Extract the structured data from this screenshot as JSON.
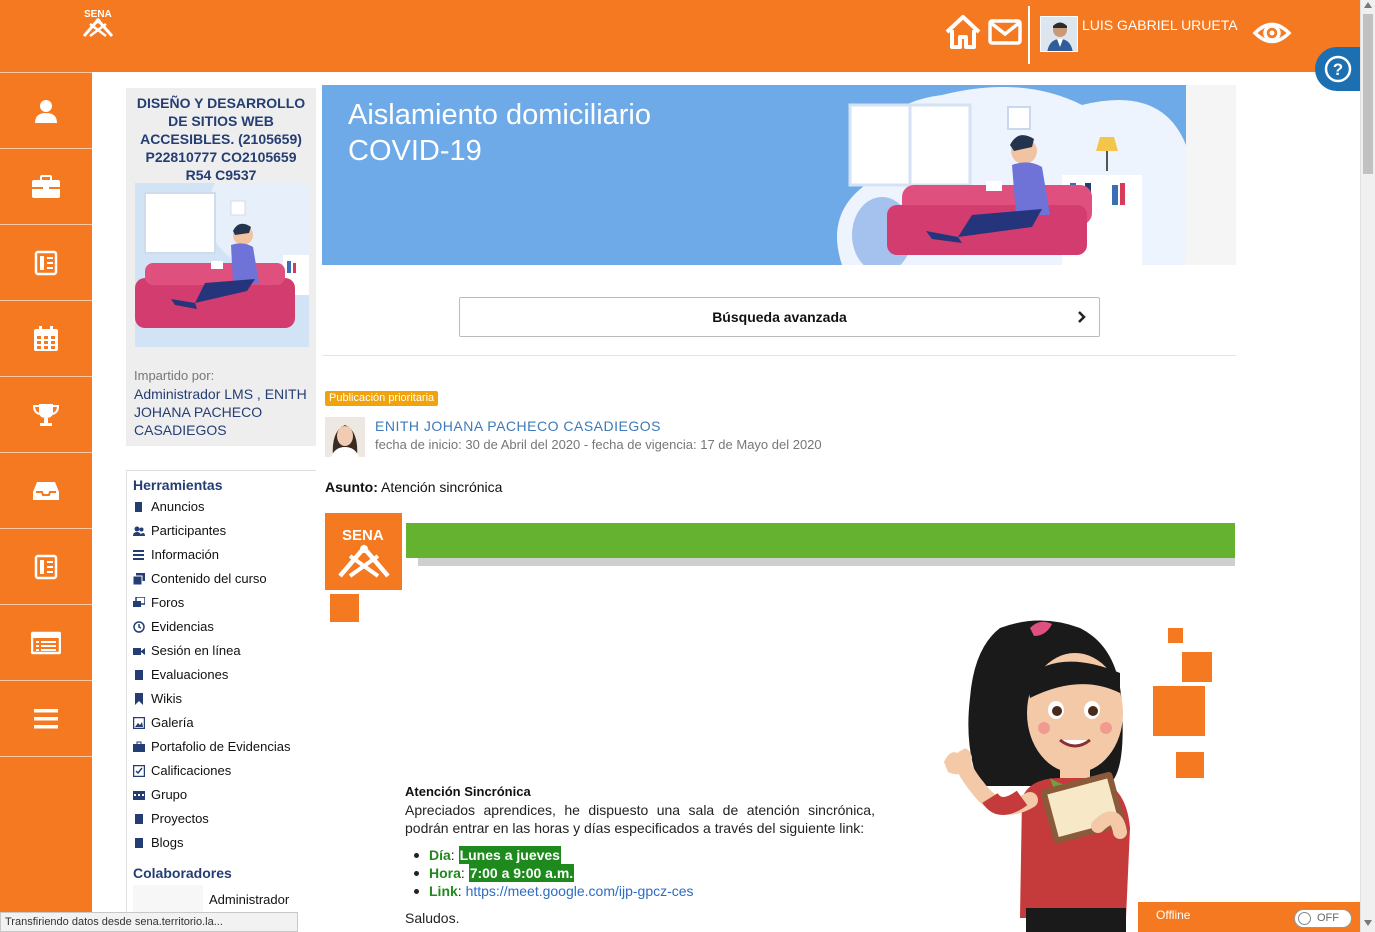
{
  "header": {
    "logo_text": "SENA",
    "user_name": "LUIS GABRIEL URUETA",
    "brand_color": "#f47920",
    "help_label": "?"
  },
  "sidebar": {
    "icons": [
      "user-icon",
      "briefcase-icon",
      "book-icon",
      "calendar-icon",
      "trophy-icon",
      "inbox-icon",
      "book-icon",
      "list-icon",
      "menu-icon"
    ]
  },
  "course": {
    "title": "DISEÑO Y DESARROLLO DE SITIOS WEB ACCESIBLES. (2105659) P22810777 CO2105659 R54 C9537",
    "taught_label": "Impartido por:",
    "taught_names": "Administrador LMS , ENITH JOHANA PACHECO CASADIEGOS"
  },
  "tools": {
    "title": "Herramientas",
    "items": [
      {
        "label": "Anuncios",
        "icon": "announcement-icon"
      },
      {
        "label": "Participantes",
        "icon": "participants-icon"
      },
      {
        "label": "Información",
        "icon": "info-icon"
      },
      {
        "label": "Contenido del curso",
        "icon": "content-icon"
      },
      {
        "label": "Foros",
        "icon": "forum-icon"
      },
      {
        "label": "Evidencias",
        "icon": "evidence-icon"
      },
      {
        "label": "Sesión en línea",
        "icon": "video-icon"
      },
      {
        "label": "Evaluaciones",
        "icon": "evaluation-icon"
      },
      {
        "label": "Wikis",
        "icon": "bookmark-icon"
      },
      {
        "label": "Galería",
        "icon": "gallery-icon"
      },
      {
        "label": "Portafolio de Evidencias",
        "icon": "portfolio-icon"
      },
      {
        "label": "Calificaciones",
        "icon": "grades-icon"
      },
      {
        "label": "Grupo",
        "icon": "group-icon"
      },
      {
        "label": "Proyectos",
        "icon": "projects-icon"
      },
      {
        "label": "Blogs",
        "icon": "blog-icon"
      }
    ],
    "collaborators_title": "Colaboradores",
    "collaborator_name": "Administrador"
  },
  "status_bar": "Transfiriendo datos desde sena.territorio.la...",
  "banner": {
    "line1": "Aislamiento domiciliario",
    "line2": "COVID-19"
  },
  "search": {
    "advanced_label": "Búsqueda avanzada"
  },
  "post": {
    "badge": "Publicación prioritaria",
    "author": "ENITH JOHANA PACHECO CASADIEGOS",
    "dates": "fecha de inicio: 30 de Abril del 2020 - fecha de vigencia: 17 de Mayo del 2020",
    "subject_label": "Asunto:",
    "subject": "Atención sincrónica",
    "logo_text": "SENA",
    "content_title": "Atención Sincrónica",
    "content_body": "Apreciados aprendices, he dispuesto una sala de atención sincrónica, podrán entrar en las horas y días especificados a través del siguiente link:",
    "day_label": "Día",
    "day_value": "Lunes a jueves",
    "hour_label": "Hora",
    "hour_value": "7:00 a 9:00 a.m.",
    "link_label": "Link",
    "link_value": "https://meet.google.com/ijp-gpcz-ces",
    "greeting": "Saludos.",
    "accent_green": "#64b22f"
  },
  "offline": {
    "label": "Offline",
    "toggle": "OFF"
  }
}
